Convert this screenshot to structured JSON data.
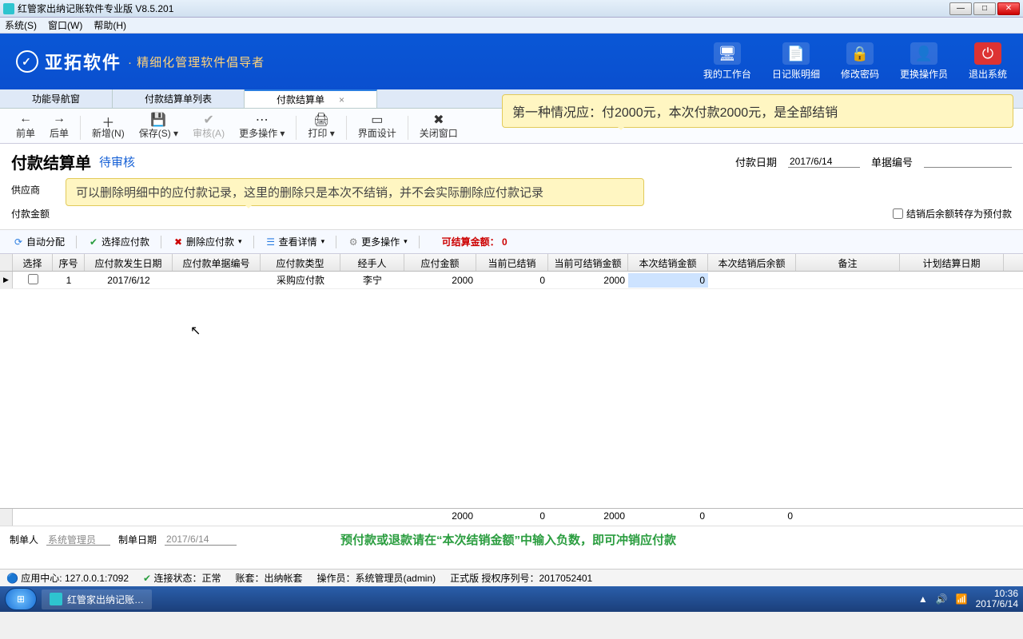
{
  "window": {
    "title": "红管家出纳记账软件专业版  V8.5.201"
  },
  "menubar": [
    "系统(S)",
    "窗口(W)",
    "帮助(H)"
  ],
  "brand": {
    "name": "亚拓软件",
    "slogan": "· 精细化管理软件倡导者"
  },
  "header_buttons": [
    {
      "label": "我的工作台",
      "icon": "🖥"
    },
    {
      "label": "日记账明细",
      "icon": "📄"
    },
    {
      "label": "修改密码",
      "icon": "🔒"
    },
    {
      "label": "更换操作员",
      "icon": "👤"
    },
    {
      "label": "退出系统",
      "icon": "⏻",
      "style": "exit"
    }
  ],
  "tabs": [
    {
      "label": "功能导航窗"
    },
    {
      "label": "付款结算单列表"
    },
    {
      "label": "付款结算单",
      "active": true,
      "closable": true
    }
  ],
  "toolbar": [
    {
      "label": "前单",
      "icon": "←"
    },
    {
      "label": "后单",
      "icon": "→"
    },
    {
      "label": "新增(N)",
      "icon": "＋"
    },
    {
      "label": "保存(S)",
      "icon": "💾",
      "dropdown": true
    },
    {
      "label": "审核(A)",
      "icon": "✔",
      "disabled": true
    },
    {
      "label": "更多操作",
      "icon": "⋯",
      "dropdown": true
    },
    {
      "label": "打印",
      "icon": "🖨",
      "dropdown": true
    },
    {
      "label": "界面设计",
      "icon": "▭"
    },
    {
      "label": "关闭窗口",
      "icon": "✖"
    }
  ],
  "callouts": {
    "top": "第一种情况应：付2000元，本次付款2000元，是全部结销",
    "mid": "可以删除明细中的应付款记录，这里的删除只是本次不结销，并不会实际删除应付款记录"
  },
  "form": {
    "title": "付款结算单",
    "status": "待审核",
    "pay_date_label": "付款日期",
    "pay_date": "2017/6/14",
    "doc_no_label": "单据编号",
    "doc_no": "",
    "supplier_label": "供应商",
    "pay_amount_label": "付款金额",
    "checkbox_label": "结销后余额转存为预付款"
  },
  "subtoolbar": {
    "auto_alloc": "自动分配",
    "select_pay": "选择应付款",
    "delete_pay": "删除应付款",
    "view_detail": "查看详情",
    "more": "更多操作",
    "settle_label": "可结算金额：",
    "settle_value": "0"
  },
  "grid": {
    "columns": [
      "选择",
      "序号",
      "应付款发生日期",
      "应付款单据编号",
      "应付款类型",
      "经手人",
      "应付金额",
      "当前已结销",
      "当前可结销金额",
      "本次结销金额",
      "本次结销后余额",
      "备注",
      "计划结算日期"
    ],
    "rows": [
      {
        "select": false,
        "seq": "1",
        "date": "2017/6/12",
        "no": "",
        "type": "采购应付款",
        "handler": "李宁",
        "amt": "2000",
        "settled": "0",
        "cansettle": "2000",
        "thisamt": "0",
        "thisbal": "",
        "memo": "",
        "plan": ""
      }
    ],
    "sums": {
      "amt": "2000",
      "settled": "0",
      "cansettle": "2000",
      "thisamt": "0",
      "thisbal": "0"
    }
  },
  "footer": {
    "maker_label": "制单人",
    "maker": "系统管理员",
    "make_date_label": "制单日期",
    "make_date": "2017/6/14",
    "note": "预付款或退款请在“本次结销金额”中输入负数，即可冲销应付款"
  },
  "statusbar": {
    "app_center": "应用中心: 127.0.0.1:7092",
    "conn": "连接状态：正常",
    "book": "账套：出纳帐套",
    "operator": "操作员：系统管理员(admin)",
    "edition": "正式版  授权序列号：2017052401"
  },
  "taskbar": {
    "app": "红管家出纳记账…",
    "time": "10:36",
    "date": "2017/6/14"
  }
}
